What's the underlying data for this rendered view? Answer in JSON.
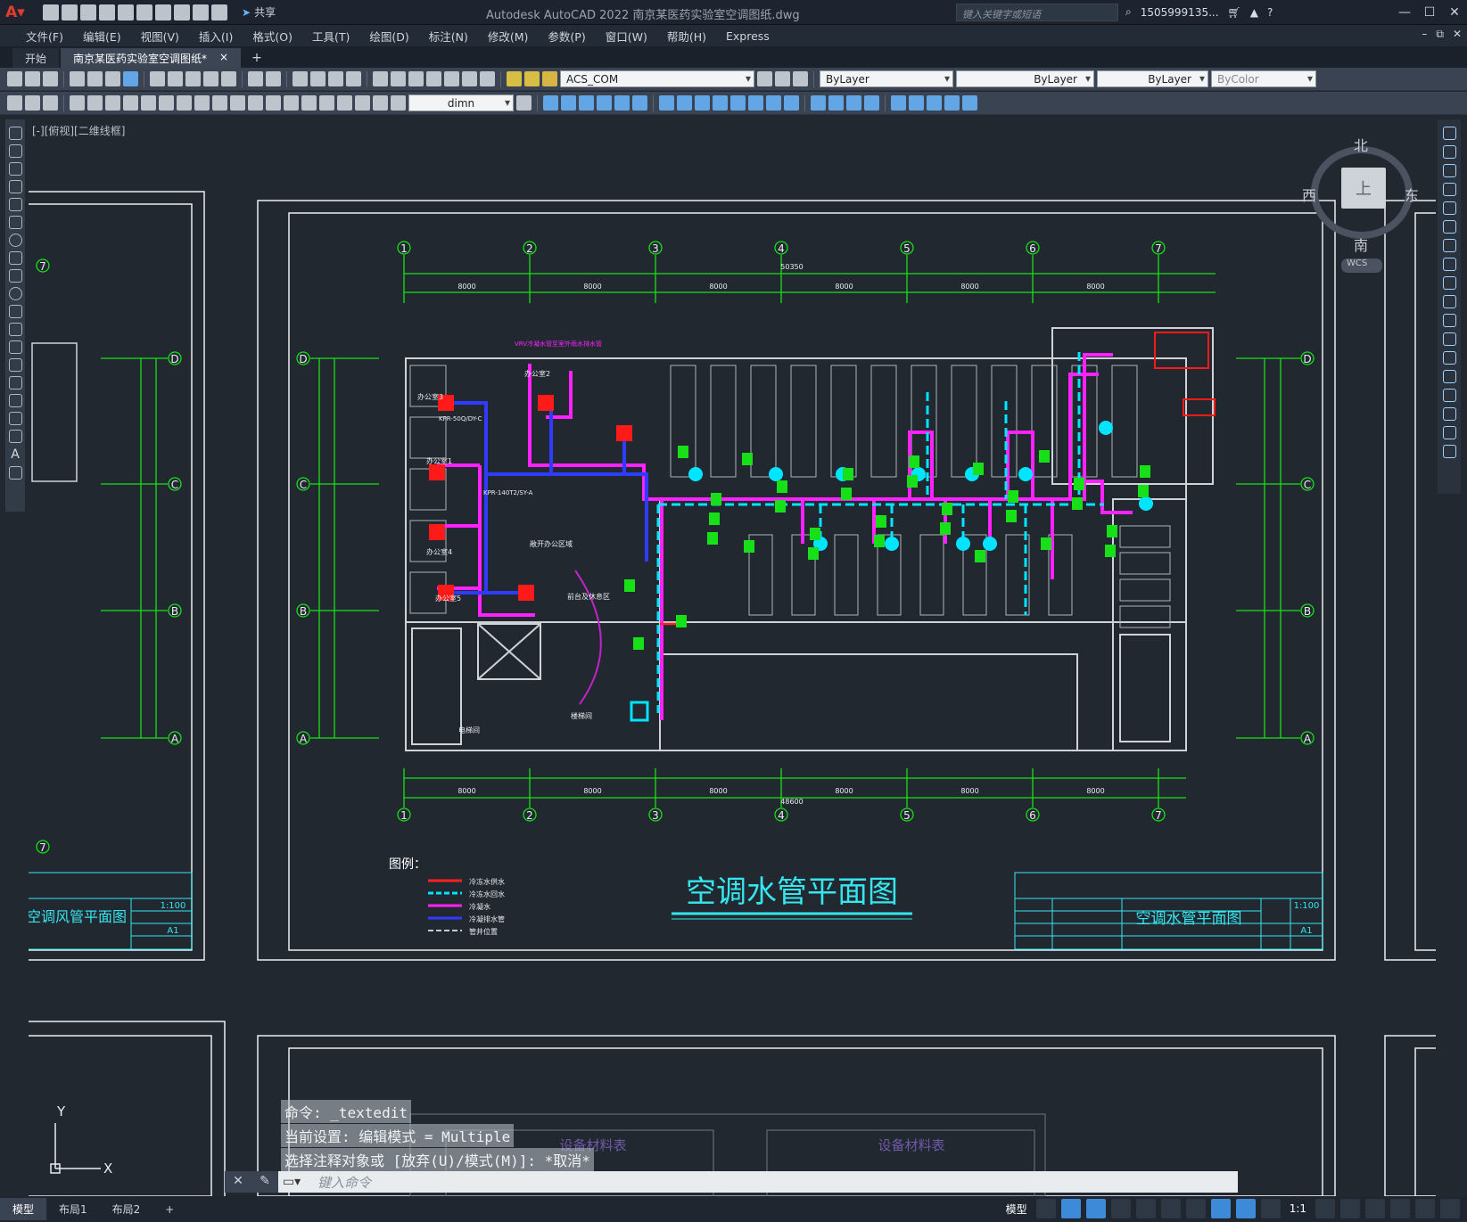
{
  "app": {
    "title": "Autodesk AutoCAD 2022    南京某医药实验室空调图纸.dwg",
    "share_label": "共享",
    "search_placeholder": "键入关键字或短语",
    "user": "1505999135..."
  },
  "menu": [
    "文件(F)",
    "编辑(E)",
    "视图(V)",
    "插入(I)",
    "格式(O)",
    "工具(T)",
    "绘图(D)",
    "标注(N)",
    "修改(M)",
    "参数(P)",
    "窗口(W)",
    "帮助(H)",
    "Express"
  ],
  "tabs": {
    "start": "开始",
    "active": "南京某医药实验室空调图纸*",
    "close": "×",
    "add": "+"
  },
  "toolbar": {
    "layer": "ACS_COM",
    "color": "ByLayer",
    "linetype": "ByLayer",
    "lineweight": "ByLayer",
    "plotstyle": "ByColor",
    "dimstyle": "dimn"
  },
  "viewport_label": "[-][俯视][二维线框]",
  "viewcube": {
    "north": "北",
    "south": "南",
    "east": "东",
    "west": "西",
    "top": "上",
    "wcs": "WCS"
  },
  "drawing": {
    "title_main": "空调水管平面图",
    "title_block_name": "空调水管平面图",
    "left_sheet_title": "空调风管平面图",
    "scale": "1:100",
    "sheet_size": "A1",
    "legend_title": "图例：",
    "legend_items": [
      {
        "label": "冷冻水供水",
        "color": "#ff2020"
      },
      {
        "label": "冷冻水回水",
        "color": "#00e5ff"
      },
      {
        "label": "冷凝水",
        "color": "#ff22ff"
      },
      {
        "label": "冷凝排水管",
        "color": "#2f3bff"
      },
      {
        "label": "管井位置",
        "color": "#ffffff"
      }
    ],
    "grid_cols": [
      "1",
      "2",
      "3",
      "4",
      "5",
      "6",
      "7"
    ],
    "grid_rows": [
      "D",
      "C",
      "B",
      "A"
    ],
    "top_dims": [
      "8000",
      "8000",
      "8000",
      "8000",
      "8000",
      "8000"
    ],
    "total_dim_top": "50350",
    "total_dim_bottom": "48600",
    "room_labels": [
      "办公室3",
      "办公室2",
      "办公室1",
      "办公室4",
      "办公室5",
      "敞开办公区域",
      "前台及休息区",
      "楼梯间",
      "电梯间"
    ],
    "equipment_labels": [
      "KPR-50Q/DY-C",
      "KPR-140T2/SY-A",
      "VRV冷凝水管至室外雨水排水管"
    ],
    "bottom_sheet_title": "设备材料表"
  },
  "command": {
    "line1": "命令: _textedit",
    "line2": "当前设置: 编辑模式 = Multiple",
    "line3": "选择注释对象或 [放弃(U)/模式(M)]: *取消*",
    "placeholder": "键入命令"
  },
  "status": {
    "tabs": [
      "模型",
      "布局1",
      "布局2"
    ],
    "model": "模型",
    "scale": "1:1"
  },
  "ucs": {
    "x": "X",
    "y": "Y"
  }
}
